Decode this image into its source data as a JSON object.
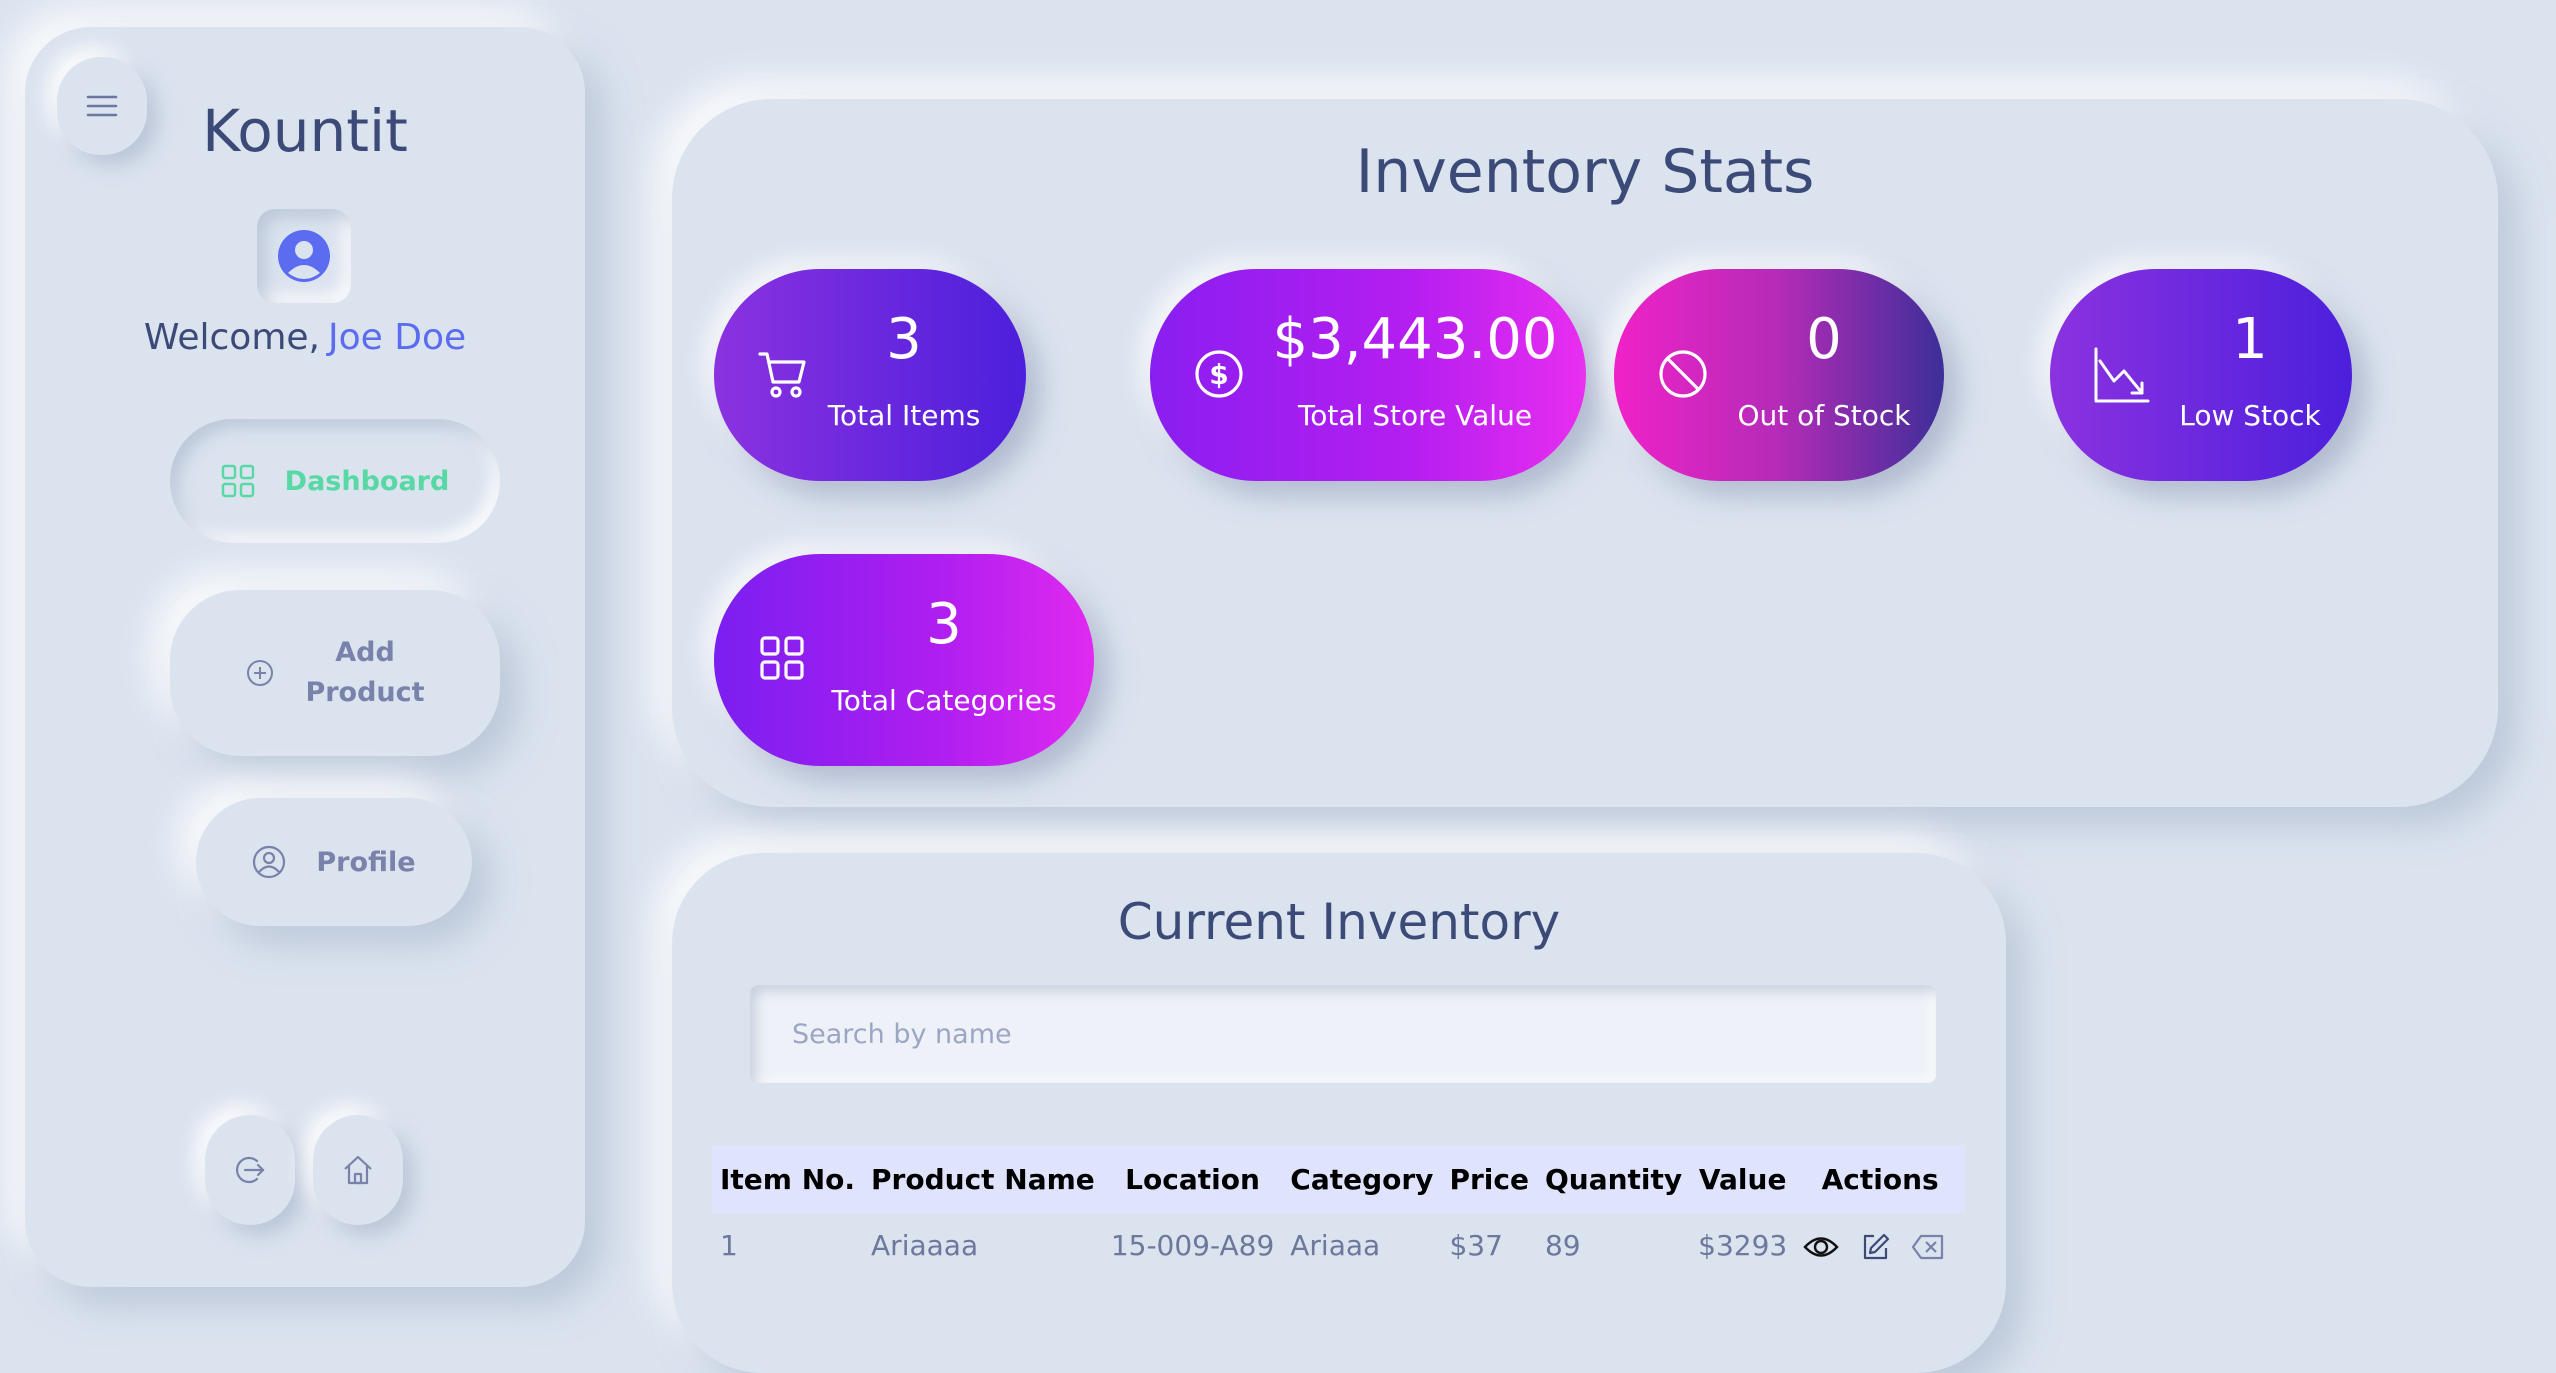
{
  "sidebar": {
    "brand": "Kountit",
    "welcome_prefix": "Welcome,",
    "user_name": "Joe Doe",
    "nav": {
      "dashboard": "Dashboard",
      "add_product_line1": "Add",
      "add_product_line2": "Product",
      "profile": "Profile"
    },
    "active_color": "#57d8a4"
  },
  "stats": {
    "title": "Inventory Stats",
    "cards": [
      {
        "value": "3",
        "label": "Total Items",
        "icon": "cart-icon"
      },
      {
        "value": "$3,443.00",
        "label": "Total Store Value",
        "icon": "dollar-icon"
      },
      {
        "value": "0",
        "label": "Out of Stock",
        "icon": "block-icon"
      },
      {
        "value": "1",
        "label": "Low Stock",
        "icon": "trend-down-icon"
      },
      {
        "value": "3",
        "label": "Total Categories",
        "icon": "grid-icon"
      }
    ]
  },
  "inventory": {
    "title": "Current Inventory",
    "search_placeholder": "Search by name",
    "headers": [
      "Item No.",
      "Product Name",
      "Location",
      "Category",
      "Price",
      "Quantity",
      "Value",
      "Actions"
    ],
    "rows": [
      {
        "item_no": "1",
        "name": "Ariaaaa",
        "location": "15-009-A89",
        "category": "Ariaaa",
        "price": "$37",
        "quantity": "89",
        "value": "$3293"
      }
    ],
    "actions": [
      "eye-icon",
      "edit-icon",
      "delete-icon"
    ]
  },
  "colors": {
    "background": "#dbe3ef",
    "text": "#3c4a78",
    "accent": "#5b6cf0"
  }
}
